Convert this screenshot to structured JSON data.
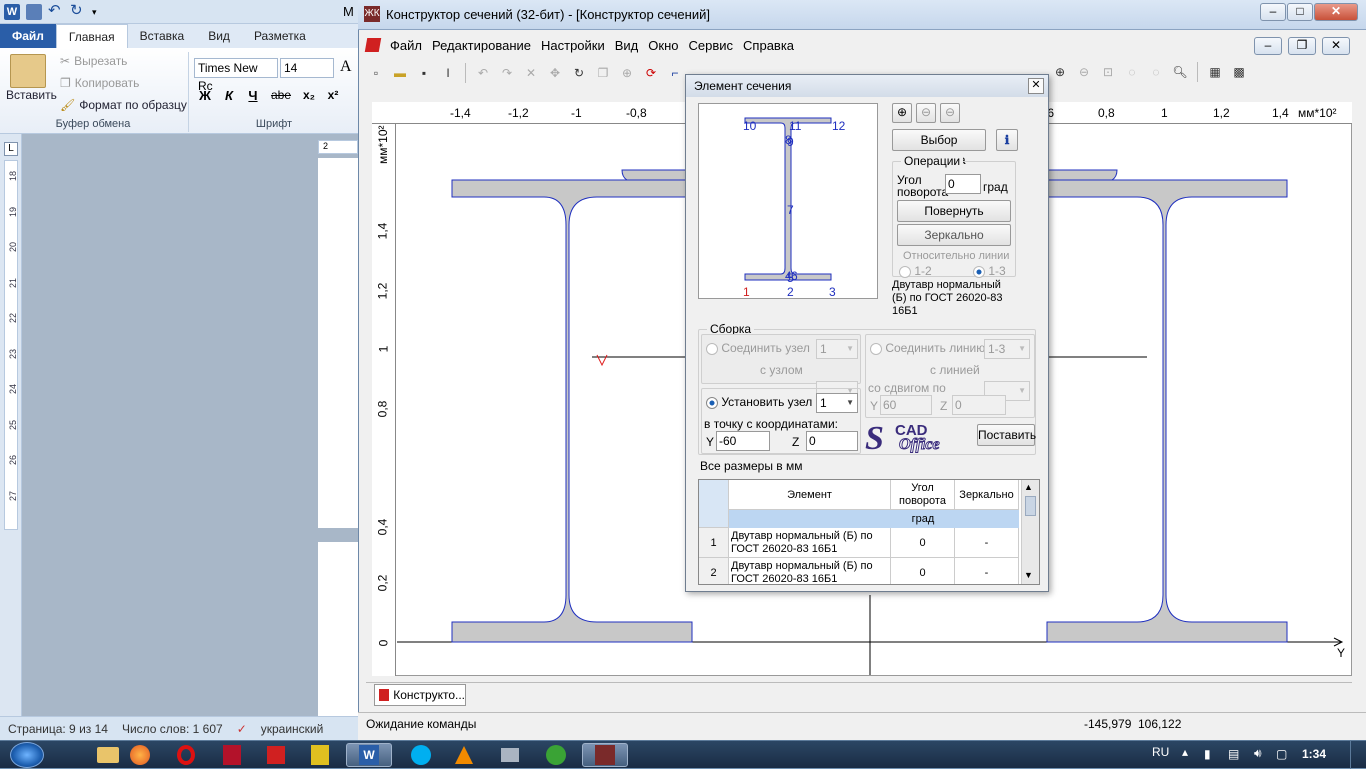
{
  "word": {
    "title_partial": "M",
    "tabs": {
      "file": "Файл",
      "home": "Главная",
      "insert": "Вставка",
      "view": "Вид",
      "layout": "Разметка страниц"
    },
    "clipboard": {
      "paste": "Вставить",
      "cut": "Вырезать",
      "copy": "Копировать",
      "format_painter": "Формат по образцу",
      "group": "Буфер обмена"
    },
    "font": {
      "name": "Times New Rc",
      "size": "14",
      "group": "Шрифт",
      "bold": "Ж",
      "italic": "К",
      "underline": "Ч",
      "strike": "abe",
      "sub": "x₂",
      "sup": "x²",
      "grow": "A"
    },
    "ruler_numbers": [
      "18",
      "19",
      "20",
      "21",
      "22",
      "23",
      "24",
      "25",
      "26",
      "27"
    ],
    "top_ruler": "2",
    "status": {
      "page": "Страница: 9 из 14",
      "words": "Число слов: 1 607",
      "lang": "украинский"
    }
  },
  "scad": {
    "title": "Конструктор сечений (32-бит) - [Конструктор сечений]",
    "menu": [
      "Файл",
      "Редактирование",
      "Настройки",
      "Вид",
      "Окно",
      "Сервис",
      "Справка"
    ],
    "ruler_x": [
      "-1,4",
      "-1,2",
      "-1",
      "-0,8",
      ",6",
      "0,8",
      "1",
      "1,2",
      "1,4"
    ],
    "ruler_x_unit": "мм*10²",
    "ruler_y": [
      "1,4",
      "1,2",
      "1",
      "0,8",
      "0,4",
      "0,2",
      "0"
    ],
    "ruler_y_unit": "мм*10²",
    "axis_y_label": "Y",
    "doc_tab": "Конструкто...",
    "status_text": "Ожидание команды",
    "coord_x": "-145,979",
    "coord_y": "106,122"
  },
  "dialog": {
    "title": "Элемент сечения",
    "preview_nodes": [
      "10",
      "11",
      "12",
      "9",
      "8",
      "7",
      "4",
      "5",
      "6",
      "1",
      "2",
      "3"
    ],
    "select_element": "Выбор элемента",
    "operations": {
      "label": "Операции",
      "angle_label": "Угол поворота",
      "angle_value": "0",
      "angle_unit": "град",
      "rotate": "Повернуть",
      "mirror": "Зеркально",
      "relative": "Относительно линии",
      "opt1": "1-2",
      "opt2": "1-3"
    },
    "element_name": "Двутавр нормальный (Б) по ГОСТ 26020-83  16Б1",
    "assembly": {
      "label": "Сборка",
      "join_node": "Соединить узел",
      "join_node_val": "1",
      "with_node": "с узлом",
      "join_line": "Соединить линию",
      "join_line_val": "1-3",
      "with_line": "с линией",
      "shift": "со сдвигом по",
      "shift_y_label": "Y",
      "shift_y": "60",
      "shift_z_label": "Z",
      "shift_z": "0",
      "set_node": "Установить узел",
      "set_node_val": "1",
      "to_point": "в точку с координатами:",
      "y_label": "Y",
      "y_val": "-60",
      "z_label": "Z",
      "z_val": "0",
      "place": "Поставить"
    },
    "logo": {
      "s": "S",
      "cad": "CAD",
      "office": "Office"
    },
    "all_sizes": "Все размеры в мм",
    "table": {
      "headers": [
        "Элемент",
        "Угол поворота",
        "Зеркально"
      ],
      "unit_row": "град",
      "rows": [
        {
          "n": "1",
          "el": "Двутавр нормальный (Б) по ГОСТ 26020-83  16Б1",
          "ang": "0",
          "mir": "-"
        },
        {
          "n": "2",
          "el": "Двутавр нормальный (Б) по ГОСТ 26020-83  16Б1",
          "ang": "0",
          "mir": "-"
        }
      ]
    }
  },
  "taskbar": {
    "lang": "RU",
    "time": "1:34"
  },
  "colors": {
    "profile_fill": "#c8c8c8",
    "profile_stroke": "#1f2fbf",
    "accent": "#2a5ea8",
    "unit_row": "#bcd6f2"
  }
}
